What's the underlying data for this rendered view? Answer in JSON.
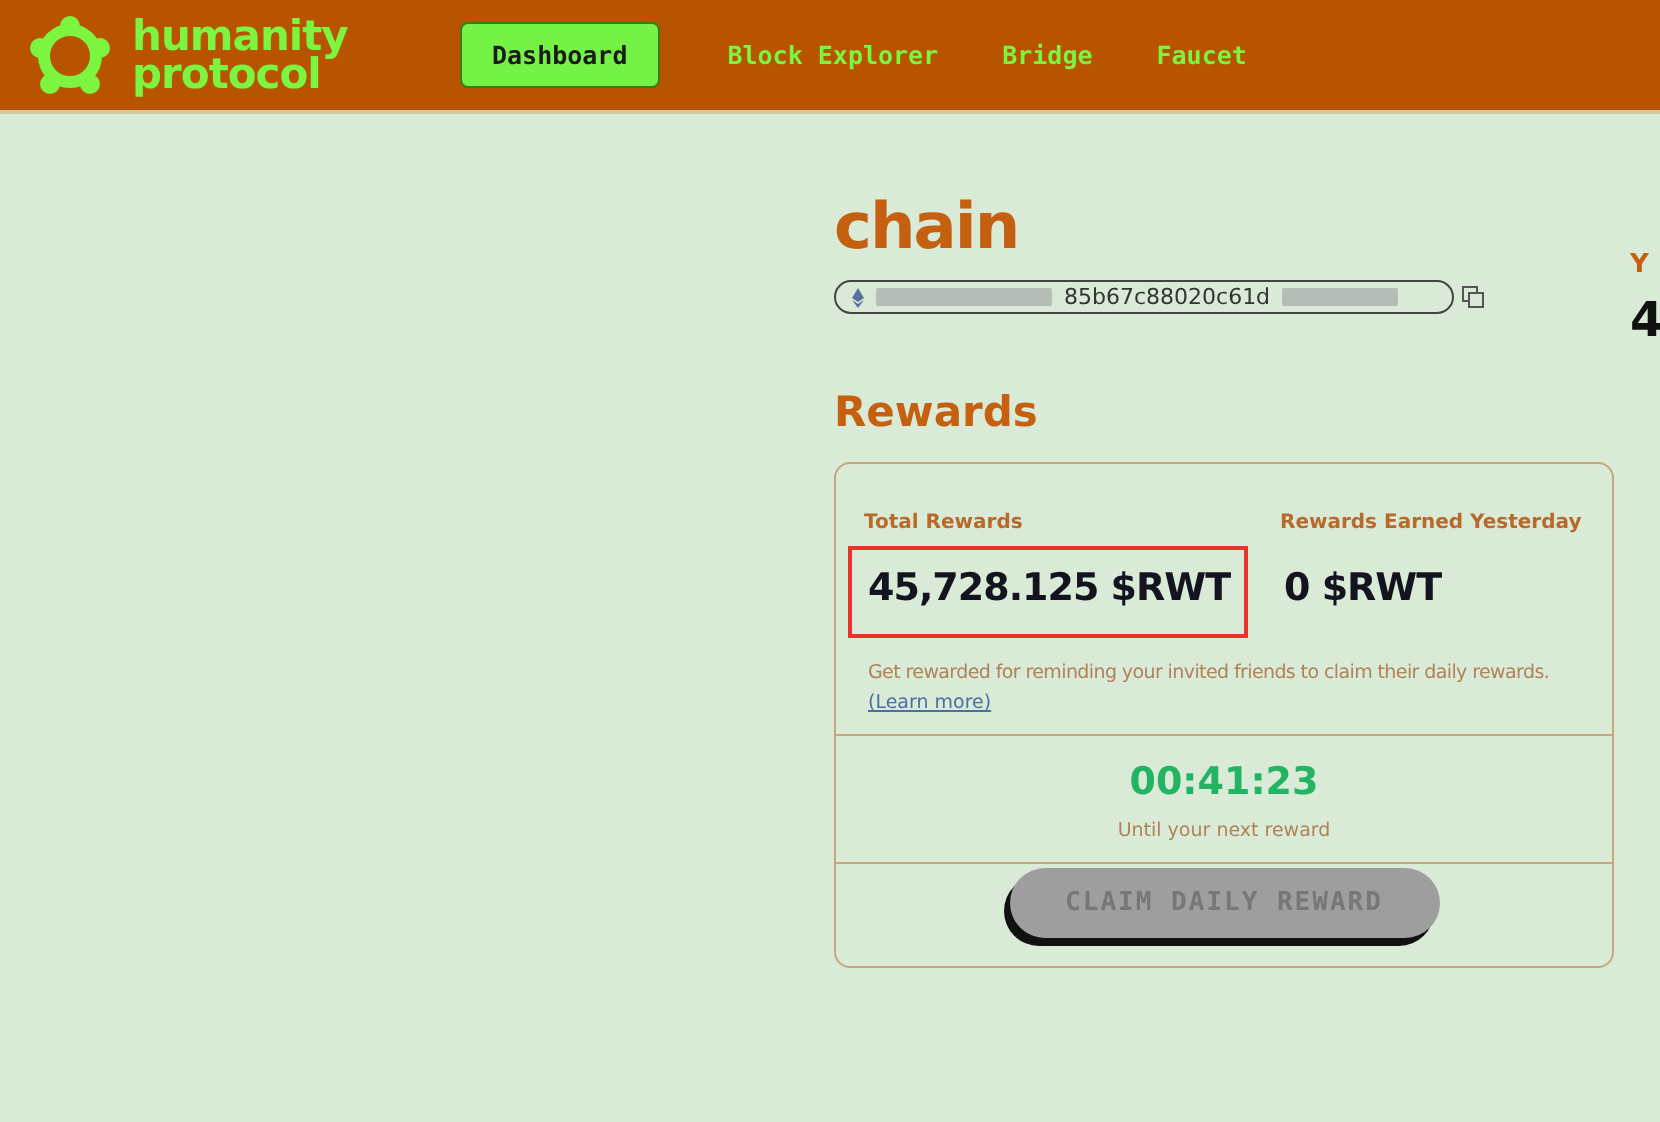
{
  "header": {
    "logo_text": "humanity protocol",
    "nav": [
      {
        "label": "Dashboard",
        "selected": true
      },
      {
        "label": "Block Explorer",
        "selected": false
      },
      {
        "label": "Bridge",
        "selected": false
      },
      {
        "label": "Faucet",
        "selected": false
      }
    ]
  },
  "profile": {
    "title": "chain",
    "address": "85b67c88020c61d"
  },
  "side_column": {
    "heading": "Y",
    "value": "4"
  },
  "rewards": {
    "heading": "Rewards",
    "stats": [
      {
        "label": "Total Rewards",
        "value": "45,728.125 $RWT",
        "highlighted": true
      },
      {
        "label": "Rewards Earned Yesterday",
        "value": "0 $RWT",
        "highlighted": false
      }
    ],
    "note": "Get rewarded for reminding your invited friends to claim their daily rewards.",
    "link": "(Learn more)",
    "timer": "00:41:23",
    "timer_caption": "Until your next reward",
    "claim_button": {
      "label": "CLAIM DAILY REWARD",
      "disabled": true
    }
  }
}
